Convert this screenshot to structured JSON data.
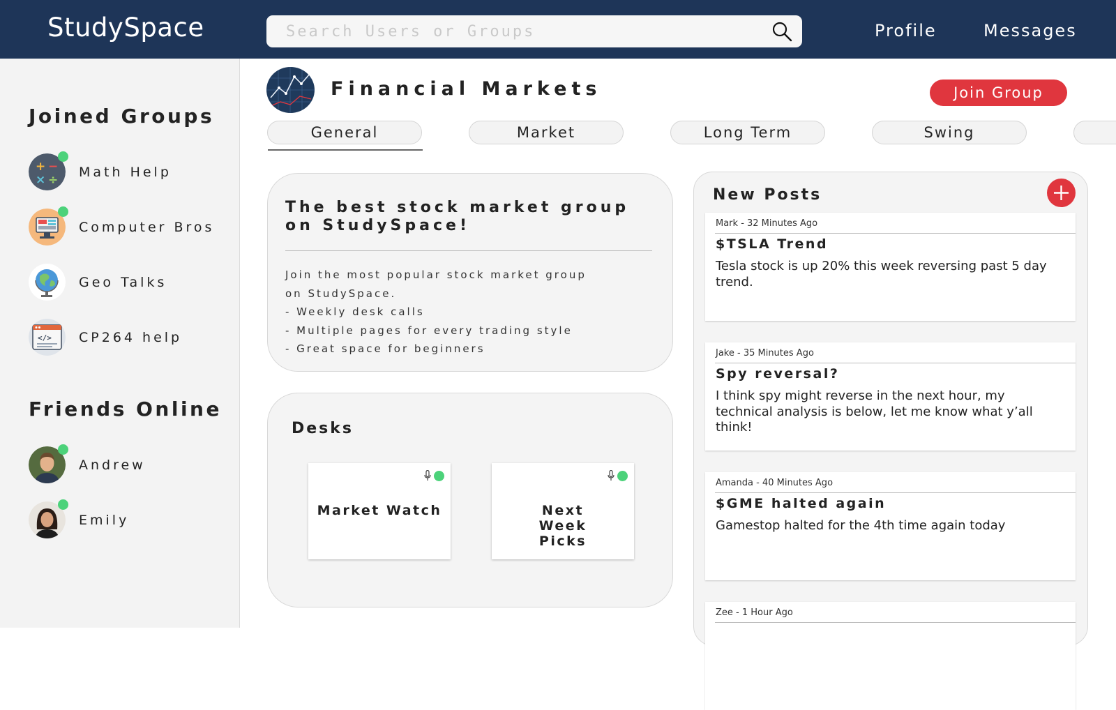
{
  "app": {
    "title": "StudySpace"
  },
  "search": {
    "placeholder": "Search Users or Groups",
    "value": ""
  },
  "nav": {
    "profile": "Profile",
    "messages": "Messages"
  },
  "sidebar": {
    "joined_title": "Joined Groups",
    "groups": [
      {
        "label": "Math Help",
        "icon": "math-symbols-icon",
        "online": true
      },
      {
        "label": "Computer Bros",
        "icon": "computer-icon",
        "online": true
      },
      {
        "label": "Geo Talks",
        "icon": "globe-icon",
        "online": false
      },
      {
        "label": "CP264 help",
        "icon": "code-window-icon",
        "online": false
      }
    ],
    "friends_title": "Friends Online",
    "friends": [
      {
        "label": "Andrew",
        "online": true
      },
      {
        "label": "Emily",
        "online": true
      }
    ]
  },
  "group": {
    "title": "Financial Markets",
    "join_label": "Join Group",
    "tabs": [
      "General",
      "Market",
      "Long Term",
      "Swing"
    ],
    "active_tab": "General"
  },
  "about": {
    "title": "The best stock market group on StudySpace!",
    "lines": [
      "Join the most popular stock market group",
      "on StudySpace.",
      "- Weekly desk calls",
      "- Multiple pages for every trading style",
      "- Great space for beginners"
    ]
  },
  "desks": {
    "title": "Desks",
    "items": [
      {
        "name": "Market Watch",
        "live": true
      },
      {
        "name": "Next Week Picks",
        "live": true
      }
    ]
  },
  "posts": {
    "title": "New Posts",
    "items": [
      {
        "meta": "Mark - 32 Minutes Ago",
        "title": "$TSLA Trend",
        "body": "Tesla stock is up 20% this week reversing past 5 day trend."
      },
      {
        "meta": "Jake - 35 Minutes Ago",
        "title": "Spy reversal?",
        "body": "I think spy might reverse in the next hour, my technical analysis is below, let me know what y’all think!"
      },
      {
        "meta": "Amanda - 40 Minutes Ago",
        "title": "$GME halted again",
        "body": "Gamestop halted for the 4th time again today"
      },
      {
        "meta": "Zee - 1 Hour Ago",
        "title": "",
        "body": ""
      }
    ]
  },
  "colors": {
    "navy": "#1e3558",
    "accent_red": "#e0363e",
    "online_green": "#4cd27a"
  }
}
